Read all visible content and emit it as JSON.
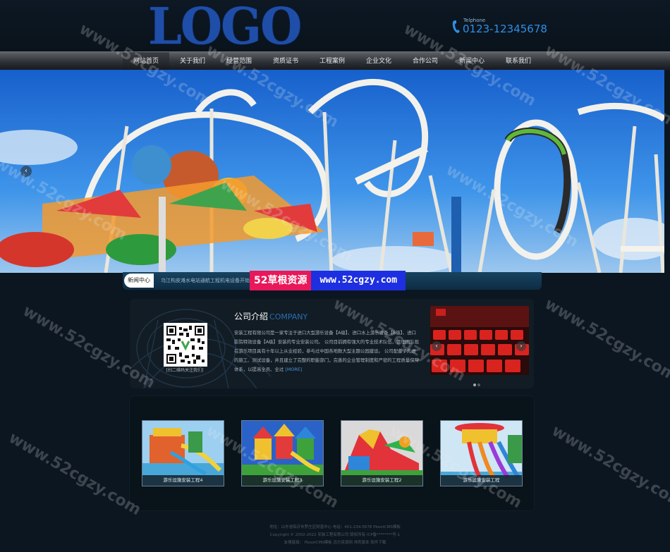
{
  "header": {
    "logo_text": "LOGO",
    "phone_label": "Telphone",
    "phone_number": "0123-12345678"
  },
  "nav": {
    "items": [
      {
        "label": "网站首页",
        "active": true
      },
      {
        "label": "关于我们"
      },
      {
        "label": "经营范围"
      },
      {
        "label": "资质证书"
      },
      {
        "label": "工程案例"
      },
      {
        "label": "企业文化"
      },
      {
        "label": "合作公司"
      },
      {
        "label": "新闻中心"
      },
      {
        "label": "联系我们"
      }
    ]
  },
  "banner": {
    "prev_icon": "chevron-left-icon",
    "prev_glyph": "‹"
  },
  "news": {
    "label": "新闻中心",
    "ticker": "乌江构皮滩水电站通航工程机电设备开始安"
  },
  "watermark": {
    "left": "52草根资源",
    "right": "www.52cgzy.com",
    "diagonal": "www.52cgzy.com"
  },
  "about": {
    "title": "公司介绍",
    "title_en": "COMPANY",
    "qr_caption": "[扫二维码关注我们]",
    "text": "安装工程有限公司是一家专注于进口大型游乐设备【A级】、进口水上游乐设备【B级】、进口影院特效设备【A级】安装的专业安装公司。 公司目前拥有强大的专业技术队伍，管理团队现在游乐项目具有十年以上从业经验，参与过中国各地数大型主题公园建设。 公司配备了先进的施工、测试设备，并且建立了完整的职能部门，完善的企业管理制度和严密的工程质量保障体系，以提高全员、全过",
    "more": "[MORE]",
    "photo_prev": "‹",
    "photo_next": "›"
  },
  "products": [
    {
      "label": "游乐设施安装工程4"
    },
    {
      "label": "游乐设施安装工程3"
    },
    {
      "label": "游乐设施安装工程2"
    },
    {
      "label": "游乐设施安装工程"
    }
  ],
  "footer": {
    "line1": "地址：山东省临沂市罗庄区财富中心 电话：401-234-5678 PbootCMS模板",
    "line2": "Copyright © 2002-2022 安装工程有限公司 版权所有 ICP备********号-1",
    "line3": "友情链接： PbootCMS模板  远方资源网  帅壳版本  软件下载"
  },
  "colors": {
    "accent_blue": "#2f8ee6",
    "brand_pink": "#e8185a",
    "brand_blue": "#1d2fe0"
  }
}
